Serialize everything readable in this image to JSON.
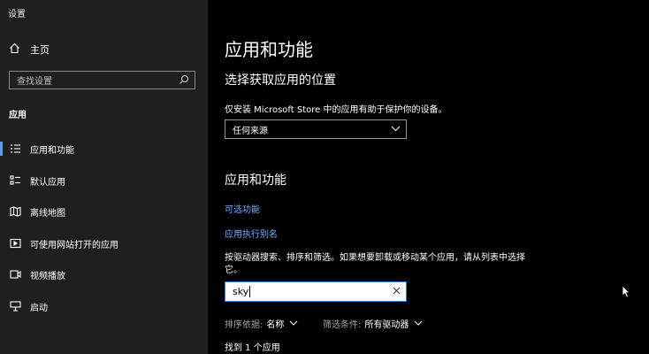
{
  "window": {
    "title": "设置"
  },
  "sidebar": {
    "home_label": "主页",
    "search_placeholder": "查找设置",
    "section": "应用",
    "items": [
      {
        "label": "应用和功能",
        "icon": "apps-features-icon",
        "active": true
      },
      {
        "label": "默认应用",
        "icon": "default-apps-icon",
        "active": false
      },
      {
        "label": "离线地图",
        "icon": "offline-maps-icon",
        "active": false
      },
      {
        "label": "可使用网站打开的应用",
        "icon": "apps-for-websites-icon",
        "active": false
      },
      {
        "label": "视频播放",
        "icon": "video-playback-icon",
        "active": false
      },
      {
        "label": "启动",
        "icon": "startup-icon",
        "active": false
      }
    ]
  },
  "main": {
    "page_title": "应用和功能",
    "install_section": {
      "title": "选择获取应用的位置",
      "description": "仅安装 Microsoft Store 中的应用有助于保护你的设备。",
      "dropdown_value": "任何来源"
    },
    "apps_section": {
      "title": "应用和功能",
      "link_optional": "可选功能",
      "link_alias": "应用执行别名",
      "description": "按驱动器搜索、排序和筛选。如果想要卸载或移动某个应用，请从列表中选择它。",
      "search_value": "sky",
      "sort_label": "排序依据:",
      "sort_value": "名称",
      "filter_label": "筛选条件:",
      "filter_value": "所有驱动器",
      "result_count": "找到 1 个应用"
    }
  },
  "colors": {
    "sidebar_bg": "#1f1f1f",
    "main_bg": "#000000",
    "accent": "#5aa0e6",
    "link": "#6fb0ff"
  }
}
